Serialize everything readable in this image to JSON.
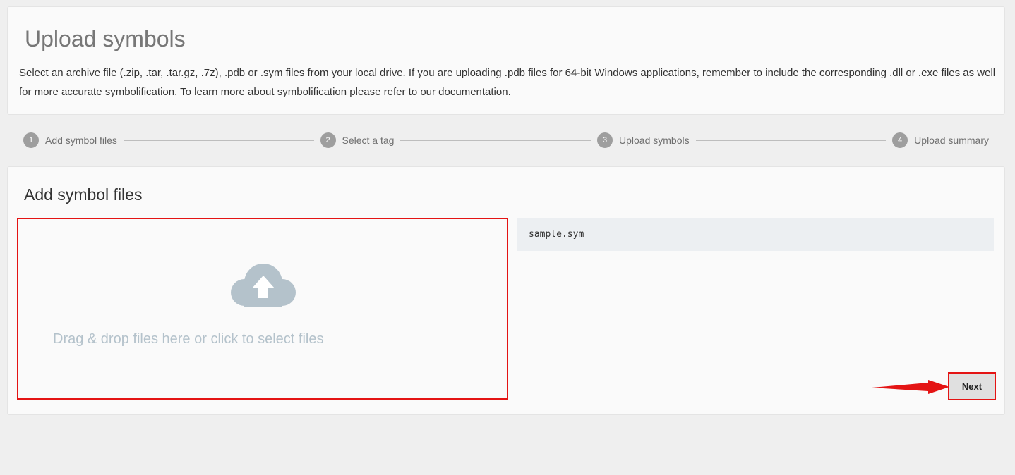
{
  "header": {
    "title": "Upload symbols",
    "description": "Select an archive file (.zip, .tar, .tar.gz, .7z), .pdb or .sym files from your local drive. If you are uploading .pdb files for 64-bit Windows applications, remember to include the corresponding .dll or .exe files as well for more accurate symbolification. To learn more about symbolification please refer to our documentation."
  },
  "stepper": {
    "steps": [
      {
        "number": "1",
        "label": "Add symbol files"
      },
      {
        "number": "2",
        "label": "Select a tag"
      },
      {
        "number": "3",
        "label": "Upload symbols"
      },
      {
        "number": "4",
        "label": "Upload summary"
      }
    ]
  },
  "main": {
    "title": "Add symbol files",
    "dropzone": {
      "icon": "cloud-upload-icon",
      "text": "Drag & drop files here or click to select files"
    },
    "files": [
      "sample.sym"
    ],
    "next_label": "Next"
  },
  "colors": {
    "background": "#efefef",
    "card": "#fafafa",
    "highlight": "#e41414",
    "cloud": "#b4c2cb",
    "file_item": "#eceff2",
    "step_circle": "#9e9e9e"
  }
}
